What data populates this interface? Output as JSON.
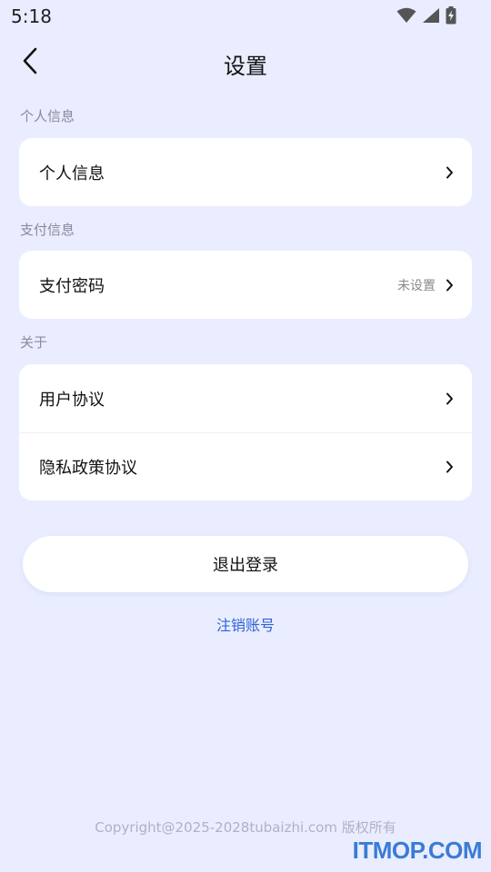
{
  "status_bar": {
    "time": "5:18",
    "icons": [
      "wifi-icon",
      "cellular-signal-icon",
      "battery-charging-icon"
    ]
  },
  "header": {
    "back_icon": "chevron-left-icon",
    "title": "设置"
  },
  "sections": [
    {
      "label": "个人信息",
      "rows": [
        {
          "label": "个人信息",
          "value": ""
        }
      ]
    },
    {
      "label": "支付信息",
      "rows": [
        {
          "label": "支付密码",
          "value": "未设置"
        }
      ]
    },
    {
      "label": "关于",
      "rows": [
        {
          "label": "用户协议",
          "value": ""
        },
        {
          "label": "隐私政策协议",
          "value": ""
        }
      ]
    }
  ],
  "actions": {
    "logout_label": "退出登录",
    "cancel_account_label": "注销账号"
  },
  "footer": {
    "copyright": "Copyright@2025-2028tubaizhi.com 版权所有",
    "watermark": "ITMOP.COM"
  },
  "colors": {
    "background": "#e9edff",
    "card": "#ffffff",
    "link": "#2f63d8",
    "muted_text": "#8a8a9a",
    "watermark": "#3a7bd5"
  }
}
